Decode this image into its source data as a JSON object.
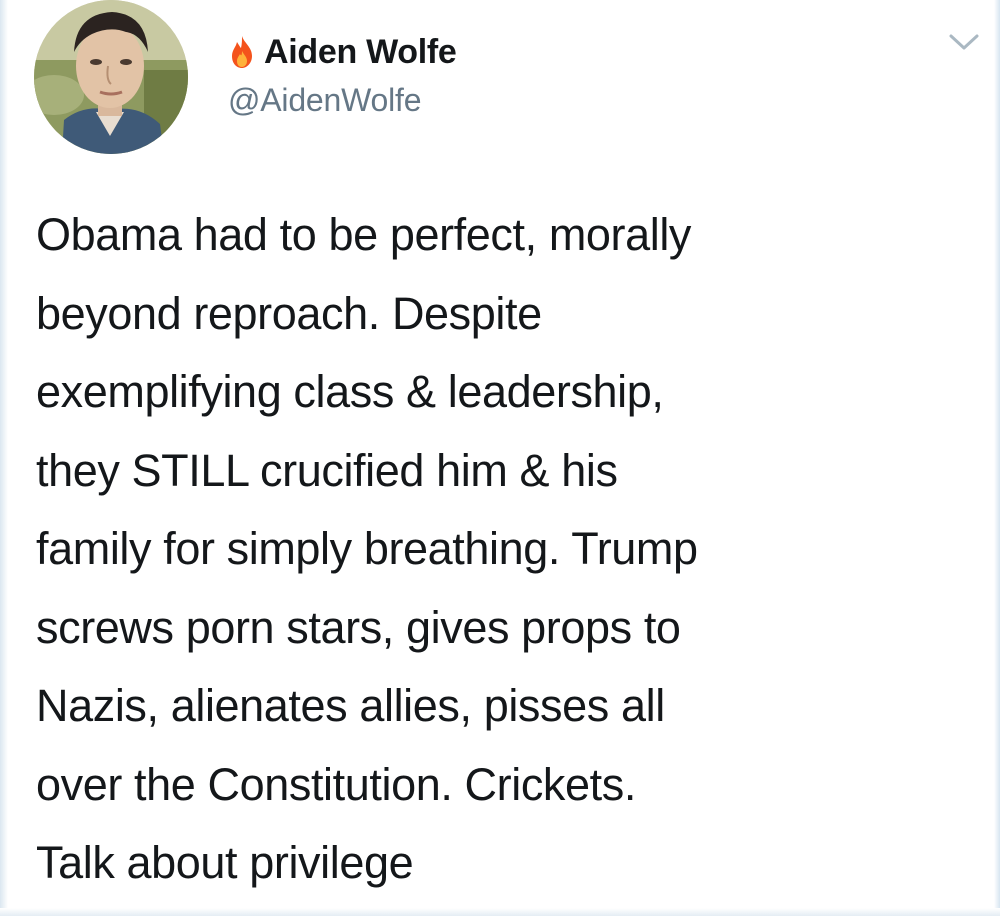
{
  "tweet": {
    "user": {
      "name_icon": "fire-icon",
      "display_name": "Aiden Wolfe",
      "handle": "@AidenWolfe",
      "avatar": "profile-photo"
    },
    "menu_icon": "chevron-down-icon",
    "text_lines": [
      "Obama had to be perfect, morally",
      "beyond reproach. Despite",
      "exemplifying class & leadership,",
      "they STILL crucified him & his",
      "family for simply breathing. Trump",
      "screws porn stars, gives props to",
      "Nazis, alienates allies, pisses all",
      "over the Constitution. Crickets.",
      "Talk about privilege"
    ]
  },
  "colors": {
    "text": "#14171a",
    "secondary": "#657786",
    "caret": "#aab8c2",
    "fire": "#f4531c"
  }
}
